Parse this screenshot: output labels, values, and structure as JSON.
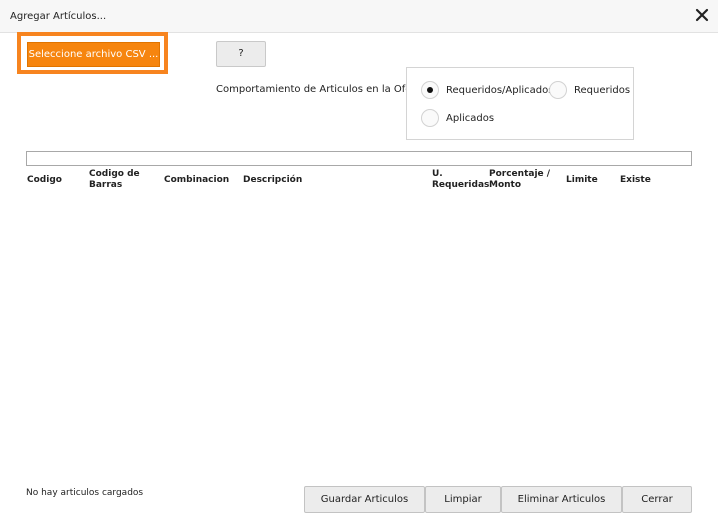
{
  "window": {
    "title": "Agregar Artículos...",
    "close_icon": "close-icon"
  },
  "toolbar": {
    "select_csv_label": "Seleccione archivo CSV ...",
    "help_label": "?"
  },
  "behavior": {
    "label": "Comportamiento de Articulos en la Oferta:",
    "options": [
      {
        "label": "Requeridos/Aplicados",
        "selected": true
      },
      {
        "label": "Requeridos",
        "selected": false
      },
      {
        "label": "Aplicados",
        "selected": false
      }
    ]
  },
  "table": {
    "columns": [
      {
        "line1": "Codigo",
        "line2": ""
      },
      {
        "line1": "Codigo de",
        "line2": "Barras"
      },
      {
        "line1": "Combinacion",
        "line2": ""
      },
      {
        "line1": "Descripción",
        "line2": ""
      },
      {
        "line1": "U.",
        "line2": "Requeridas"
      },
      {
        "line1": "Porcentaje /",
        "line2": "Monto"
      },
      {
        "line1": "Limite",
        "line2": ""
      },
      {
        "line1": "Existe",
        "line2": ""
      }
    ],
    "rows": []
  },
  "footer": {
    "status_text": "No hay articulos cargados",
    "save_label": "Guardar Articulos",
    "clear_label": "Limpiar",
    "delete_label": "Eliminar Articulos",
    "close_label": "Cerrar"
  },
  "colors": {
    "accent": "#f6850f",
    "accent_border": "#f7841f"
  }
}
